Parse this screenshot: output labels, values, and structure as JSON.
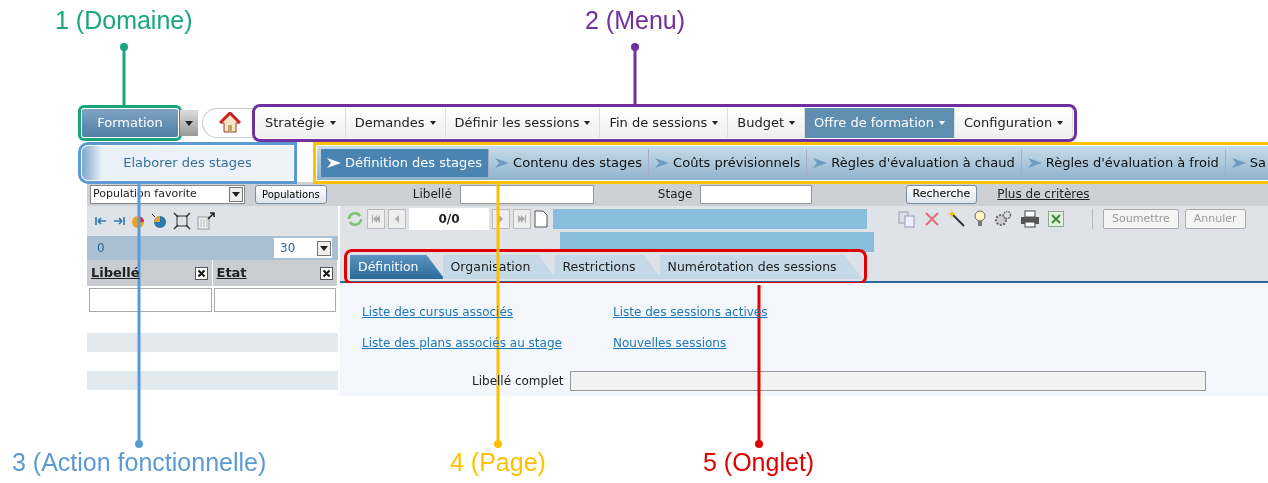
{
  "annotations": [
    {
      "label": "1 (Domaine)",
      "color": "#1aa57f"
    },
    {
      "label": "2 (Menu)",
      "color": "#7030a0"
    },
    {
      "label": "3 (Action fonctionnelle)",
      "color": "#5b9bd5"
    },
    {
      "label": "4 (Page)",
      "color": "#ffc000"
    },
    {
      "label": "5 (Onglet)",
      "color": "#e00000"
    }
  ],
  "domain": {
    "label": "Formation"
  },
  "menu": [
    {
      "label": "Stratégie",
      "selected": false
    },
    {
      "label": "Demandes",
      "selected": false
    },
    {
      "label": "Définir les sessions",
      "selected": false
    },
    {
      "label": "Fin de sessions",
      "selected": false
    },
    {
      "label": "Budget",
      "selected": false
    },
    {
      "label": "Offre de formation",
      "selected": true
    },
    {
      "label": "Configuration",
      "selected": false
    }
  ],
  "action": {
    "label": "Elaborer des stages"
  },
  "pages": [
    {
      "label": "Définition des stages",
      "selected": true
    },
    {
      "label": "Contenu des stages",
      "selected": false
    },
    {
      "label": "Coûts prévisionnels",
      "selected": false
    },
    {
      "label": "Règles d'évaluation à chaud",
      "selected": false
    },
    {
      "label": "Règles d'évaluation à froid",
      "selected": false
    },
    {
      "label": "Sa",
      "selected": false
    }
  ],
  "filter": {
    "population": "Population favorite",
    "populations_button": "Populations",
    "libelle_label": "Libellé",
    "stage_label": "Stage",
    "search_button": "Recherche",
    "more_link": "Plus de critères"
  },
  "list": {
    "count": "0",
    "page_size": "30",
    "columns": [
      "Libellé",
      "Etat"
    ]
  },
  "record": {
    "position": "0/0",
    "buttons": [
      {
        "label": "Soumettre",
        "disabled": true
      },
      {
        "label": "Annuler",
        "disabled": true
      }
    ]
  },
  "tabs": [
    {
      "label": "Définition",
      "selected": true
    },
    {
      "label": "Organisation",
      "selected": false
    },
    {
      "label": "Restrictions",
      "selected": false
    },
    {
      "label": "Numérotation des sessions",
      "selected": false
    }
  ],
  "links": [
    "Liste des cursus associés",
    "Liste des sessions actives",
    "Liste des plans associés au stage",
    "Nouvelles sessions"
  ],
  "field": {
    "label": "Libellé complet"
  }
}
